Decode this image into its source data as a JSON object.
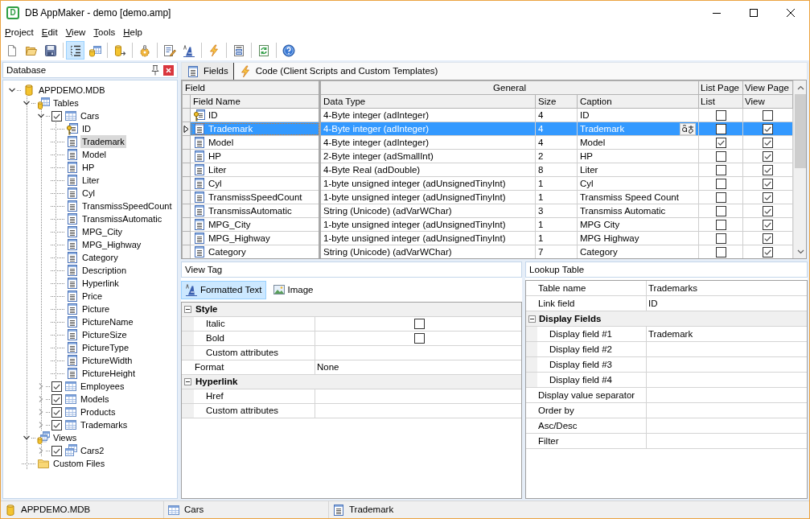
{
  "window": {
    "logo": "D",
    "title": "DB AppMaker - demo [demo.amp]"
  },
  "menu": [
    "Project",
    "Edit",
    "View",
    "Tools",
    "Help"
  ],
  "toolbar_groups": [
    {
      "buttons": [
        {
          "kind": "new",
          "pressed": false
        },
        {
          "kind": "open",
          "pressed": false
        },
        {
          "kind": "save",
          "pressed": false
        }
      ]
    },
    {
      "buttons": [
        {
          "kind": "tree",
          "pressed": true
        },
        {
          "kind": "forms",
          "pressed": false
        }
      ]
    },
    {
      "buttons": [
        {
          "kind": "export",
          "pressed": false
        }
      ]
    },
    {
      "buttons": [
        {
          "kind": "plugin",
          "pressed": false
        }
      ]
    },
    {
      "buttons": [
        {
          "kind": "edit",
          "pressed": false
        },
        {
          "kind": "font",
          "pressed": false
        }
      ]
    },
    {
      "buttons": [
        {
          "kind": "script",
          "pressed": false
        }
      ]
    },
    {
      "buttons": [
        {
          "kind": "form",
          "pressed": false
        }
      ]
    },
    {
      "buttons": [
        {
          "kind": "refresh",
          "pressed": false
        }
      ]
    },
    {
      "buttons": [
        {
          "kind": "help",
          "pressed": false
        }
      ]
    }
  ],
  "database_panel": {
    "title": "Database",
    "tree": [
      {
        "kind": "database",
        "label": "APPDEMO.MDB",
        "expanded": true,
        "selected": false,
        "children": [
          {
            "kind": "tables",
            "label": "Tables",
            "expanded": true,
            "selected": false,
            "children": [
              {
                "kind": "table",
                "label": "Cars",
                "expanded": true,
                "checked": true,
                "selected": false,
                "children": [
                  {
                    "kind": "key_field",
                    "label": "ID",
                    "selected": false
                  },
                  {
                    "kind": "field",
                    "label": "Trademark",
                    "selected": true
                  },
                  {
                    "kind": "field",
                    "label": "Model",
                    "selected": false
                  },
                  {
                    "kind": "field",
                    "label": "HP",
                    "selected": false
                  },
                  {
                    "kind": "field",
                    "label": "Liter",
                    "selected": false
                  },
                  {
                    "kind": "field",
                    "label": "Cyl",
                    "selected": false
                  },
                  {
                    "kind": "field",
                    "label": "TransmissSpeedCount",
                    "selected": false
                  },
                  {
                    "kind": "field",
                    "label": "TransmissAutomatic",
                    "selected": false
                  },
                  {
                    "kind": "field",
                    "label": "MPG_City",
                    "selected": false
                  },
                  {
                    "kind": "field",
                    "label": "MPG_Highway",
                    "selected": false
                  },
                  {
                    "kind": "field",
                    "label": "Category",
                    "selected": false
                  },
                  {
                    "kind": "field",
                    "label": "Description",
                    "selected": false
                  },
                  {
                    "kind": "field",
                    "label": "Hyperlink",
                    "selected": false
                  },
                  {
                    "kind": "field",
                    "label": "Price",
                    "selected": false
                  },
                  {
                    "kind": "field",
                    "label": "Picture",
                    "selected": false
                  },
                  {
                    "kind": "field",
                    "label": "PictureName",
                    "selected": false
                  },
                  {
                    "kind": "field",
                    "label": "PictureSize",
                    "selected": false
                  },
                  {
                    "kind": "field",
                    "label": "PictureType",
                    "selected": false
                  },
                  {
                    "kind": "field",
                    "label": "PictureWidth",
                    "selected": false
                  },
                  {
                    "kind": "field",
                    "label": "PictureHeight",
                    "selected": false
                  }
                ]
              },
              {
                "kind": "table",
                "label": "Employees",
                "expanded": false,
                "checked": true,
                "selected": false
              },
              {
                "kind": "table",
                "label": "Models",
                "expanded": false,
                "checked": true,
                "selected": false
              },
              {
                "kind": "table",
                "label": "Products",
                "expanded": false,
                "checked": true,
                "selected": false
              },
              {
                "kind": "table",
                "label": "Trademarks",
                "expanded": false,
                "checked": true,
                "selected": false
              }
            ]
          },
          {
            "kind": "views",
            "label": "Views",
            "expanded": true,
            "selected": false,
            "children": [
              {
                "kind": "view",
                "label": "Cars2",
                "expanded": false,
                "checked": true,
                "selected": false
              }
            ]
          },
          {
            "kind": "folder",
            "label": "Custom Files",
            "selected": false
          }
        ]
      }
    ]
  },
  "tabs": [
    {
      "kind": "fields",
      "label": "Fields",
      "selected": true
    },
    {
      "kind": "code",
      "label": "Code (Client Scripts and Custom Templates)",
      "selected": false
    }
  ],
  "fields_grid": {
    "column_groups": [
      {
        "label": "Field",
        "columns": [
          "Field Name"
        ]
      },
      {
        "label": "General",
        "columns": [
          "Data Type",
          "Size",
          "Caption"
        ]
      },
      {
        "label": "List Page",
        "columns": [
          "List"
        ]
      },
      {
        "label": "View Page",
        "columns": [
          "View"
        ]
      }
    ],
    "rows": [
      {
        "kind": "key_field",
        "field_name": "ID",
        "data_type": "4-Byte integer (adInteger)",
        "size": "4",
        "caption": "ID",
        "list_page": false,
        "view_page": false,
        "selected": false
      },
      {
        "kind": "field",
        "field_name": "Trademark",
        "data_type": "4-Byte integer (adInteger)",
        "size": "4",
        "caption": "Trademark",
        "list_page": false,
        "view_page": true,
        "selected": true
      },
      {
        "kind": "field",
        "field_name": "Model",
        "data_type": "4-Byte integer (adInteger)",
        "size": "4",
        "caption": "Model",
        "list_page": true,
        "view_page": true,
        "selected": false
      },
      {
        "kind": "field",
        "field_name": "HP",
        "data_type": "2-Byte integer (adSmallInt)",
        "size": "2",
        "caption": "HP",
        "list_page": false,
        "view_page": true,
        "selected": false
      },
      {
        "kind": "field",
        "field_name": "Liter",
        "data_type": "4-Byte Real (adDouble)",
        "size": "8",
        "caption": "Liter",
        "list_page": false,
        "view_page": true,
        "selected": false
      },
      {
        "kind": "field",
        "field_name": "Cyl",
        "data_type": "1-byte unsigned integer (adUnsignedTinyInt)",
        "size": "1",
        "caption": "Cyl",
        "list_page": false,
        "view_page": true,
        "selected": false
      },
      {
        "kind": "field",
        "field_name": "TransmissSpeedCount",
        "data_type": "1-byte unsigned integer (adUnsignedTinyInt)",
        "size": "1",
        "caption": "Transmiss Speed Count",
        "list_page": false,
        "view_page": true,
        "selected": false
      },
      {
        "kind": "field",
        "field_name": "TransmissAutomatic",
        "data_type": "String (Unicode) (adVarWChar)",
        "size": "3",
        "caption": "Transmiss Automatic",
        "list_page": false,
        "view_page": true,
        "selected": false
      },
      {
        "kind": "field",
        "field_name": "MPG_City",
        "data_type": "1-byte unsigned integer (adUnsignedTinyInt)",
        "size": "1",
        "caption": "MPG City",
        "list_page": false,
        "view_page": true,
        "selected": false
      },
      {
        "kind": "field",
        "field_name": "MPG_Highway",
        "data_type": "1-byte unsigned integer (adUnsignedTinyInt)",
        "size": "1",
        "caption": "MPG Highway",
        "list_page": false,
        "view_page": true,
        "selected": false
      },
      {
        "kind": "field",
        "field_name": "Category",
        "data_type": "String (Unicode) (adVarWChar)",
        "size": "7",
        "caption": "Category",
        "list_page": false,
        "view_page": true,
        "selected": false
      }
    ]
  },
  "view_tag": {
    "title": "View Tag",
    "tabs": [
      {
        "kind": "text",
        "label": "Formatted Text",
        "selected": true
      },
      {
        "kind": "image",
        "label": "Image",
        "selected": false
      }
    ],
    "properties": [
      {
        "kind": "category",
        "label": "Style",
        "expanded": true,
        "children": [
          {
            "kind": "checkbox",
            "label": "Italic",
            "checked": false
          },
          {
            "kind": "checkbox",
            "label": "Bold",
            "checked": false
          },
          {
            "kind": "text",
            "label": "Custom attributes"
          }
        ]
      },
      {
        "kind": "text",
        "label": "Format",
        "value": "None"
      },
      {
        "kind": "category",
        "label": "Hyperlink",
        "expanded": true,
        "children": [
          {
            "kind": "text",
            "label": "Href"
          },
          {
            "kind": "text",
            "label": "Custom attributes"
          }
        ]
      }
    ]
  },
  "lookup_table": {
    "title": "Lookup Table",
    "properties": [
      {
        "kind": "text",
        "label": "Table name",
        "value": "Trademarks"
      },
      {
        "kind": "text",
        "label": "Link field",
        "value": "ID"
      },
      {
        "kind": "category",
        "label": "Display Fields",
        "expanded": true,
        "children": [
          {
            "kind": "text",
            "label": "Display field #1",
            "value": "Trademark"
          },
          {
            "kind": "text",
            "label": "Display field #2"
          },
          {
            "kind": "text",
            "label": "Display field #3"
          },
          {
            "kind": "text",
            "label": "Display field #4"
          }
        ]
      },
      {
        "kind": "text",
        "label": "Display value separator"
      },
      {
        "kind": "text",
        "label": "Order by"
      },
      {
        "kind": "text",
        "label": "Asc/Desc"
      },
      {
        "kind": "text",
        "label": "Filter"
      }
    ]
  },
  "status_bar": [
    {
      "kind": "database",
      "text": "APPDEMO.MDB"
    },
    {
      "kind": "table",
      "text": "Cars"
    },
    {
      "kind": "field",
      "text": "Trademark"
    }
  ]
}
